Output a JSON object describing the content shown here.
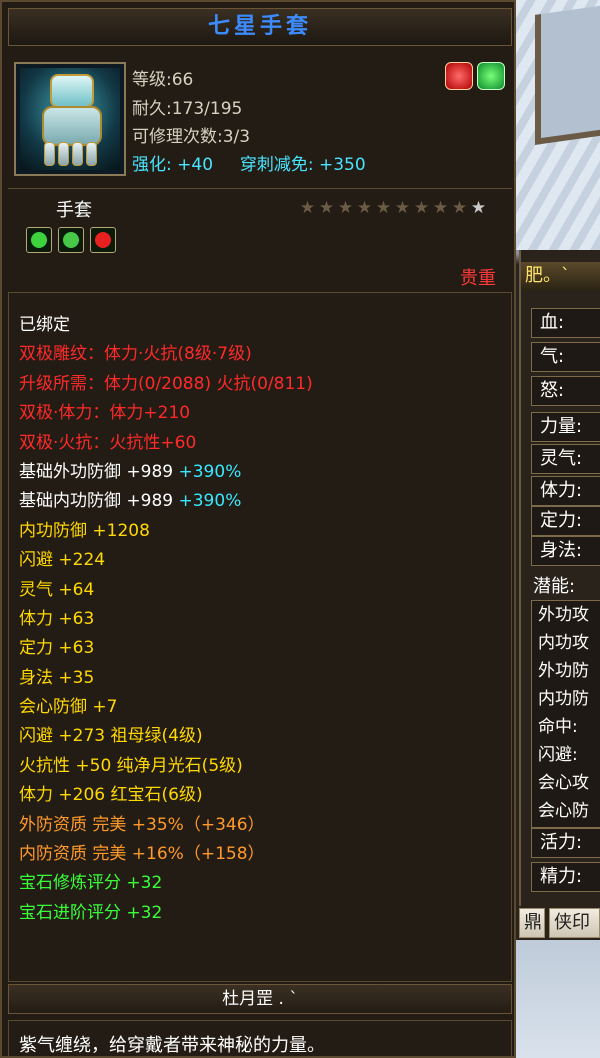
{
  "item": {
    "name": "七星手套",
    "level_line": "等级:66",
    "durability_line": "耐久:173/195",
    "repair_line": "可修理次数:3/3",
    "enhance_label": "强化:",
    "enhance_value": "+40",
    "pierce_label": "穿刺减免:",
    "pierce_value": "+350",
    "slot": "手套",
    "stars_total": 10,
    "stars_lit": 0,
    "precious": "贵重",
    "owner": "杜月罡 . `",
    "flavor": "紫气缠绕，给穿戴者带来神秘的力量。",
    "gems": [
      {
        "name": "green-gem-icon",
        "color": "#3fd23f"
      },
      {
        "name": "green-gem-icon",
        "color": "#48c848"
      },
      {
        "name": "red-gem-icon",
        "color": "#e82020"
      }
    ]
  },
  "attributes": {
    "bound": "已绑定",
    "dual_carve": "双极雕纹：体力·火抗(8级·7级)",
    "upgrade_req": "升级所需：体力(0/2088)  火抗(0/811)",
    "dual_str": "双极·体力：体力+210",
    "dual_fire": "双极·火抗：火抗性+60",
    "base_ext_label": "基础外功防御 +989 ",
    "base_ext_pct": "+390%",
    "base_int_label": "基础内功防御 +989 ",
    "base_int_pct": "+390%",
    "yellow_lines": [
      "内功防御 +1208",
      "闪避 +224",
      "灵气 +64",
      "体力 +63",
      "定力 +63",
      "身法 +35",
      "会心防御 +7"
    ],
    "gem_lines": [
      "闪避 +273 祖母绿(4级)",
      "火抗性 +50 纯净月光石(5级)",
      "体力 +206 红宝石(6级)"
    ],
    "quality_lines": [
      "外防资质  完美 +35%（+346）",
      "内防资质  完美 +16%（+158）"
    ],
    "score_lines": [
      "宝石修炼评分 +32",
      "宝石进阶评分 +32"
    ]
  },
  "side_panel": {
    "title": "肥。`",
    "stats": [
      "血:",
      "气:",
      "怒:",
      "力量:",
      "灵气:",
      "体力:",
      "定力:",
      "身法:"
    ],
    "potential_label": "潜能:",
    "list": [
      "外功攻",
      "内功攻",
      "外功防",
      "内功防",
      "命中:",
      "闪避:",
      "会心攻",
      "会心防"
    ],
    "vital_labels": [
      "活力:",
      "精力:"
    ],
    "tabs": [
      "鼎",
      "侠印"
    ]
  }
}
